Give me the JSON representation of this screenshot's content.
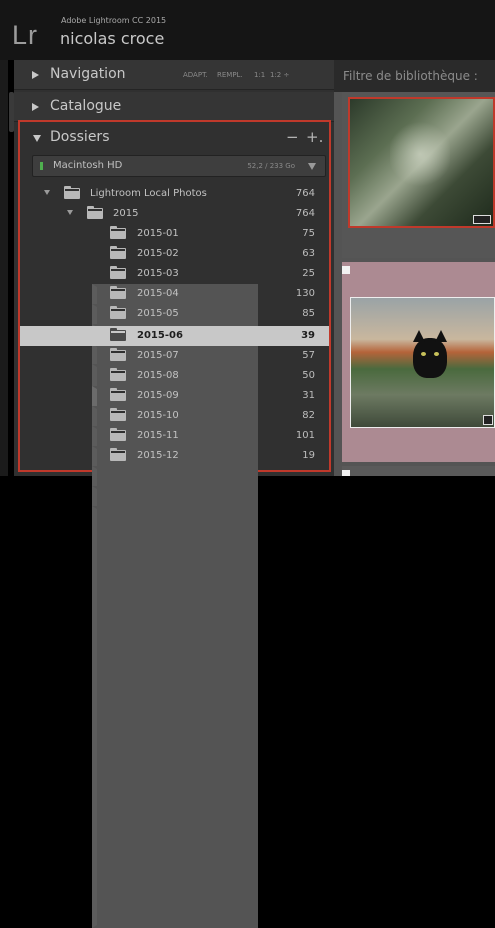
{
  "app": {
    "logo": "Lr",
    "name": "Adobe Lightroom CC 2015",
    "user": "nicolas croce"
  },
  "panels": {
    "navigation": {
      "title": "Navigation",
      "zoom": [
        "ADAPT.",
        "REMPL.",
        "1:1",
        "1:2 ÷"
      ]
    },
    "catalogue": {
      "title": "Catalogue"
    },
    "dossiers": {
      "title": "Dossiers",
      "minus": "−",
      "plus": "+."
    }
  },
  "volume": {
    "name": "Macintosh HD",
    "size": "52,2 / 233 Go",
    "indicator_color": "#4fb04f"
  },
  "tree": {
    "root": {
      "name": "Lightroom Local Photos",
      "count": "764"
    },
    "year": {
      "name": "2015",
      "count": "764"
    },
    "months": [
      {
        "name": "2015-01",
        "count": "75"
      },
      {
        "name": "2015-02",
        "count": "63"
      },
      {
        "name": "2015-03",
        "count": "25"
      },
      {
        "name": "2015-04",
        "count": "130"
      },
      {
        "name": "2015-05",
        "count": "85"
      },
      {
        "name": "2015-06",
        "count": "39"
      },
      {
        "name": "2015-07",
        "count": "57"
      },
      {
        "name": "2015-08",
        "count": "50"
      },
      {
        "name": "2015-09",
        "count": "31"
      },
      {
        "name": "2015-10",
        "count": "82"
      },
      {
        "name": "2015-11",
        "count": "101"
      },
      {
        "name": "2015-12",
        "count": "19"
      }
    ],
    "selected_month": "2015-06"
  },
  "library": {
    "filter_label": "Filtre de bibliothèque :"
  },
  "colors": {
    "highlight_border": "#c0392b",
    "selected_row": "#c8c8c8",
    "selected_cell": "#ac8a92"
  }
}
